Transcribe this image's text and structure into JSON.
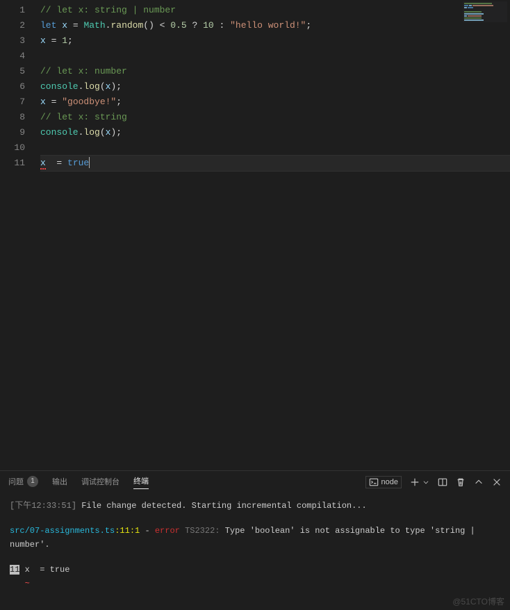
{
  "editor": {
    "lines": [
      {
        "n": 1,
        "tokens": [
          [
            "comment",
            "// let x: string | number"
          ]
        ]
      },
      {
        "n": 2,
        "tokens": [
          [
            "keyword",
            "let"
          ],
          [
            "punc",
            " "
          ],
          [
            "var",
            "x"
          ],
          [
            "punc",
            " = "
          ],
          [
            "type",
            "Math"
          ],
          [
            "punc",
            "."
          ],
          [
            "method",
            "random"
          ],
          [
            "punc",
            "() < "
          ],
          [
            "num",
            "0.5"
          ],
          [
            "punc",
            " ? "
          ],
          [
            "num",
            "10"
          ],
          [
            "punc",
            " : "
          ],
          [
            "str",
            "\"hello world!\""
          ],
          [
            "punc",
            ";"
          ]
        ]
      },
      {
        "n": 3,
        "tokens": [
          [
            "var",
            "x"
          ],
          [
            "punc",
            " = "
          ],
          [
            "num",
            "1"
          ],
          [
            "punc",
            ";"
          ]
        ]
      },
      {
        "n": 4,
        "tokens": []
      },
      {
        "n": 5,
        "tokens": [
          [
            "comment",
            "// let x: number"
          ]
        ]
      },
      {
        "n": 6,
        "tokens": [
          [
            "type",
            "console"
          ],
          [
            "punc",
            "."
          ],
          [
            "method",
            "log"
          ],
          [
            "punc",
            "("
          ],
          [
            "var",
            "x"
          ],
          [
            "punc",
            ");"
          ]
        ]
      },
      {
        "n": 7,
        "tokens": [
          [
            "var",
            "x"
          ],
          [
            "punc",
            " = "
          ],
          [
            "str",
            "\"goodbye!\""
          ],
          [
            "punc",
            ";"
          ]
        ]
      },
      {
        "n": 8,
        "tokens": [
          [
            "comment",
            "// let x: string"
          ]
        ]
      },
      {
        "n": 9,
        "tokens": [
          [
            "type",
            "console"
          ],
          [
            "punc",
            "."
          ],
          [
            "method",
            "log"
          ],
          [
            "punc",
            "("
          ],
          [
            "var",
            "x"
          ],
          [
            "punc",
            ");"
          ]
        ]
      },
      {
        "n": 10,
        "tokens": []
      },
      {
        "n": 11,
        "current": true,
        "tokens": [
          [
            "var-err",
            "x"
          ],
          [
            "punc",
            "  = "
          ],
          [
            "keyword",
            "true"
          ]
        ],
        "cursor": true
      }
    ]
  },
  "panel": {
    "tabs": {
      "problems": "问题",
      "problems_count": "1",
      "output": "输出",
      "debug": "调试控制台",
      "terminal": "终端"
    },
    "actions": {
      "node_label": "node"
    }
  },
  "terminal": {
    "timestamp_prefix": "下午12:33:51",
    "watch_msg": " File change detected. Starting incremental compilation...",
    "err_file": "src/07-assignments.ts",
    "err_loc": ":11:1",
    "err_dash": " - ",
    "err_word": "error",
    "err_code": " TS2322: ",
    "err_msg": "Type 'boolean' is not assignable to type 'string | number'.",
    "ctx_lineno": "11",
    "ctx_code": " x  = true",
    "ctx_marker": "   ~"
  },
  "watermark": "@51CTO博客"
}
